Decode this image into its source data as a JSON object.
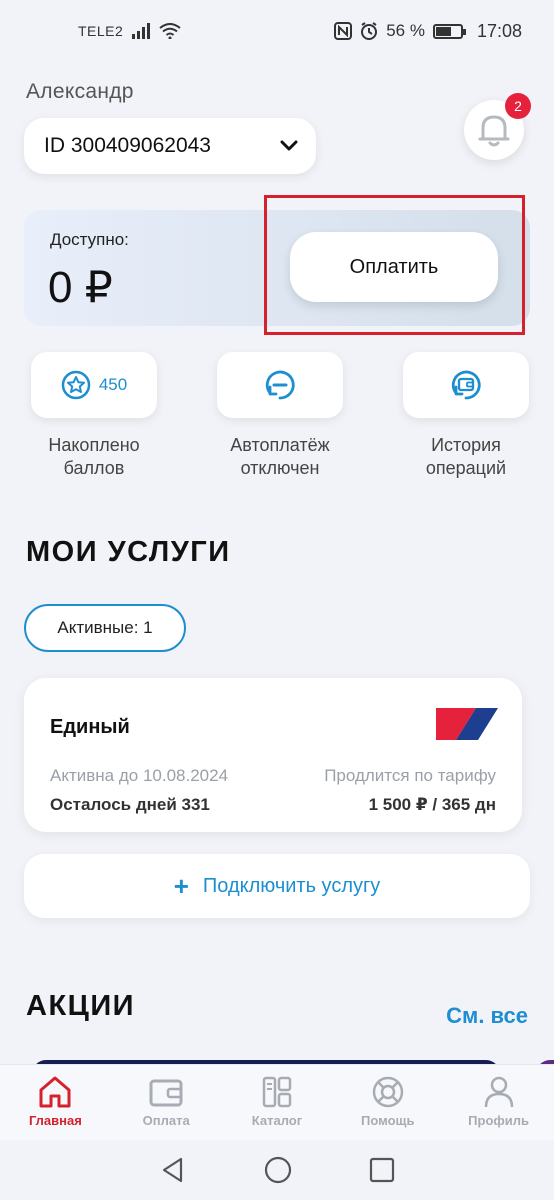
{
  "status_bar": {
    "carrier": "TELE2",
    "battery": "56 %",
    "time": "17:08"
  },
  "header": {
    "user_name": "Александр",
    "account_id": "ID 300409062043",
    "notification_count": "2"
  },
  "balance": {
    "label": "Доступно:",
    "value": "0 ₽",
    "pay_button": "Оплатить"
  },
  "quick_actions": [
    {
      "value": "450",
      "label_line1": "Накоплено",
      "label_line2": "баллов",
      "icon": "star-icon"
    },
    {
      "label_line1": "Автоплатёж",
      "label_line2": "отключен",
      "icon": "autopay-icon"
    },
    {
      "label_line1": "История",
      "label_line2": "операций",
      "icon": "wallet-history-icon"
    }
  ],
  "services": {
    "title": "МОИ УСЛУГИ",
    "filter": "Активные: 1",
    "card": {
      "name": "Единый",
      "active_until": "Активна до 10.08.2024",
      "renewal": "Продлится по тарифу",
      "days_left": "Осталось дней 331",
      "price": "1 500 ₽ / 365 дн"
    },
    "add_button": "Подключить услугу"
  },
  "promos": {
    "title": "АКЦИИ",
    "see_all": "См. все"
  },
  "bottom_nav": [
    {
      "label": "Главная",
      "icon": "home-icon",
      "active": true
    },
    {
      "label": "Оплата",
      "icon": "wallet-icon",
      "active": false
    },
    {
      "label": "Каталог",
      "icon": "catalog-icon",
      "active": false
    },
    {
      "label": "Помощь",
      "icon": "lifebuoy-icon",
      "active": false
    },
    {
      "label": "Профиль",
      "icon": "user-icon",
      "active": false
    }
  ],
  "colors": {
    "accent": "#1d8fd1",
    "alert": "#e5213b",
    "active_nav": "#d6212c",
    "background": "#f1f3f8"
  }
}
